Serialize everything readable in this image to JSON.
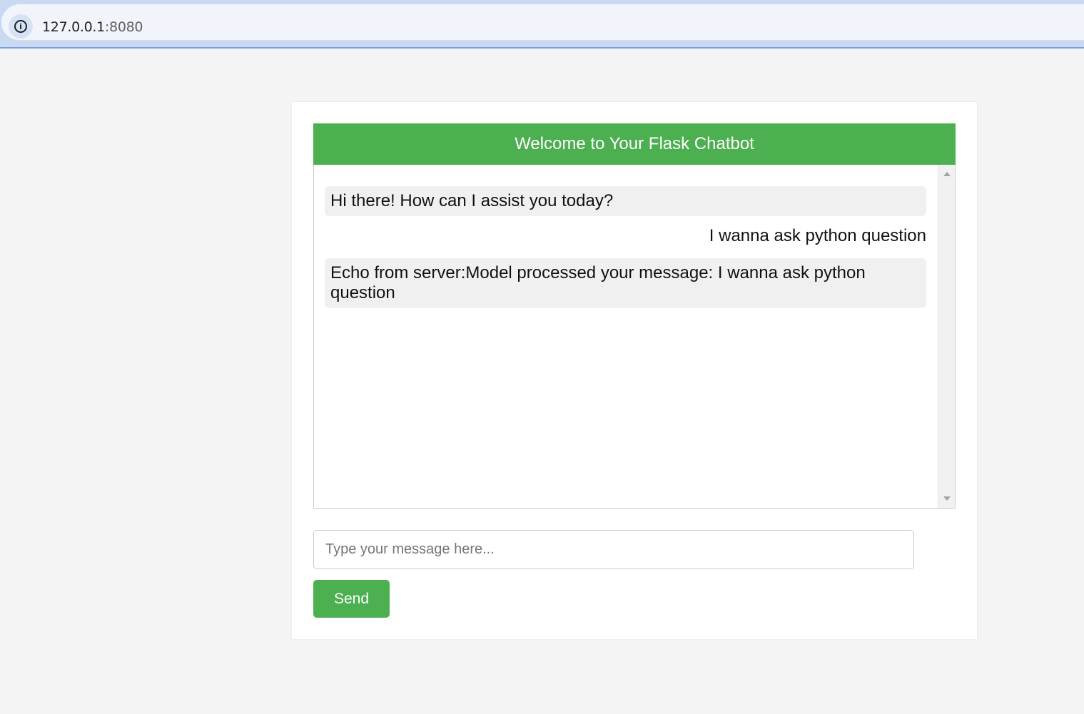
{
  "browser": {
    "url_host": "127.0.0.1",
    "url_port": ":8080",
    "info_icon_glyph": "i"
  },
  "chat": {
    "title": "Welcome to Your Flask Chatbot",
    "messages": [
      {
        "sender": "bot",
        "text": "Hi there! How can I assist you today?"
      },
      {
        "sender": "user",
        "text": "I wanna ask python question"
      },
      {
        "sender": "bot",
        "text": "Echo from server:Model processed your message: I wanna ask python question"
      }
    ],
    "input_placeholder": "Type your message here...",
    "input_value": "",
    "send_label": "Send"
  },
  "colors": {
    "accent": "#4caf50",
    "bot_bubble": "#f0f0f0",
    "page_background": "#f4f4f4"
  }
}
